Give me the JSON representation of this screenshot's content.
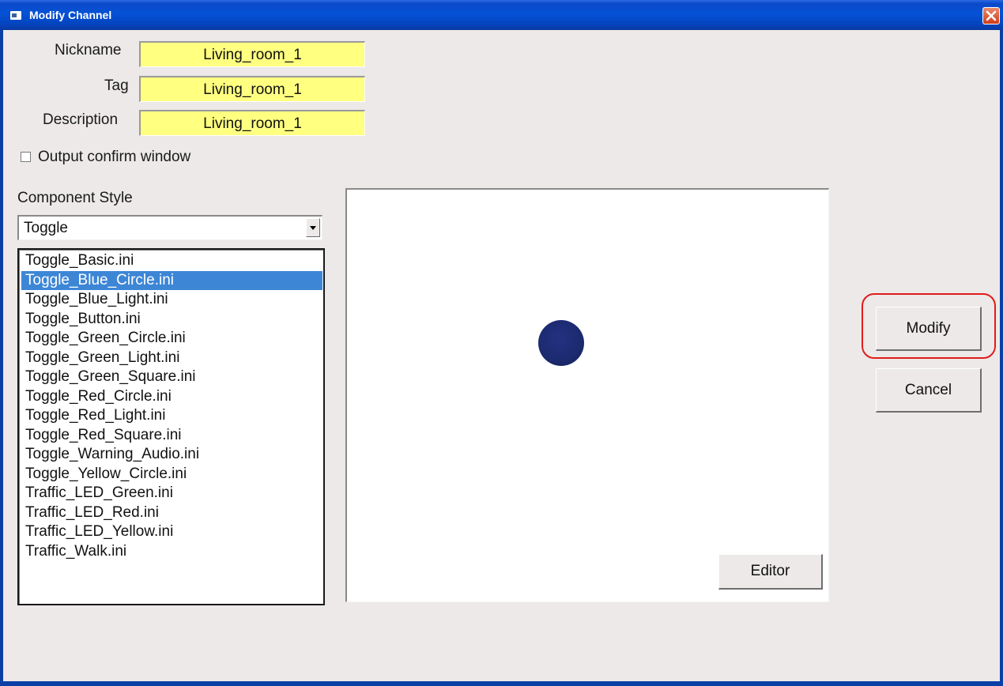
{
  "window": {
    "title": "Modify Channel"
  },
  "form": {
    "nickname_label": "Nickname",
    "nickname_value": "Living_room_1",
    "tag_label": "Tag",
    "tag_value": "Living_room_1",
    "description_label": "Description",
    "description_value": "Living_room_1",
    "output_confirm_label": "Output confirm window",
    "output_confirm_checked": false
  },
  "component_style": {
    "label": "Component Style",
    "selected": "Toggle",
    "items": [
      "Toggle_Basic.ini",
      "Toggle_Blue_Circle.ini",
      "Toggle_Blue_Light.ini",
      "Toggle_Button.ini",
      "Toggle_Green_Circle.ini",
      "Toggle_Green_Light.ini",
      "Toggle_Green_Square.ini",
      "Toggle_Red_Circle.ini",
      "Toggle_Red_Light.ini",
      "Toggle_Red_Square.ini",
      "Toggle_Warning_Audio.ini",
      "Toggle_Yellow_Circle.ini",
      "Traffic_LED_Green.ini",
      "Traffic_LED_Red.ini",
      "Traffic_LED_Yellow.ini",
      "Traffic_Walk.ini"
    ],
    "selected_item": "Toggle_Blue_Circle.ini"
  },
  "preview": {
    "editor_label": "Editor",
    "indicator_color": "#1c2a6f"
  },
  "actions": {
    "modify_label": "Modify",
    "cancel_label": "Cancel"
  },
  "colors": {
    "field_bg": "#ffff80",
    "selection": "#3d86d6",
    "titlebar": "#0552d6",
    "highlight": "#e21b1b"
  }
}
